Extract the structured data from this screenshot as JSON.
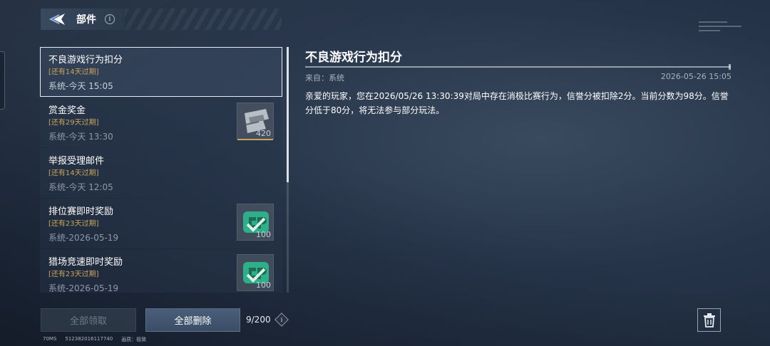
{
  "header": {
    "title": "部件",
    "back_icon": "chevron-left-icon",
    "info_icon": "i"
  },
  "mail_list": {
    "items": [
      {
        "title": "不良游戏行为扣分",
        "expire": "[还有14天过期]",
        "sender": "系统-今天 15:05",
        "selected": true,
        "attachment": null
      },
      {
        "title": "赏金奖金",
        "expire": "[还有29天过期]",
        "sender": "系统-今天 13:30",
        "selected": false,
        "attachment": {
          "icon": "ticket-icon",
          "qty": "420"
        }
      },
      {
        "title": "举报受理邮件",
        "expire": "[还有14天过期]",
        "sender": "系统-今天 12:05",
        "selected": false,
        "attachment": null
      },
      {
        "title": "排位赛即时奖励",
        "expire": "[还有23天过期]",
        "sender": "系统-2026-05-19",
        "selected": false,
        "attachment": {
          "icon": "cp-coin-icon",
          "qty": "100"
        }
      },
      {
        "title": "猎场竞速即时奖励",
        "expire": "[还有23天过期]",
        "sender": "系统-2026-05-19",
        "selected": false,
        "attachment": {
          "icon": "cp-coin-icon",
          "qty": "100"
        }
      }
    ]
  },
  "detail": {
    "title": "不良游戏行为扣分",
    "from": "来自：系统",
    "timestamp": "2026-05-26 15:05",
    "body": "亲爱的玩家，您在2026/05/26 13:30:39对局中存在消极比赛行为，信誉分被扣除2分。当前分数为98分。信誉分低于80分，将无法参与部分玩法。"
  },
  "footer": {
    "claim_all": "全部领取",
    "delete_all": "全部删除",
    "count": "9/200",
    "info_icon": "i",
    "trash_icon": "trash-icon",
    "ping": "70MS",
    "uid": "512382016117740",
    "quality_label": "画质：",
    "quality_value": "极致"
  },
  "colors": {
    "expire_gold": "#c9a55c",
    "cp_green": "#2fae8a",
    "selected_border": "#e8edf3"
  }
}
